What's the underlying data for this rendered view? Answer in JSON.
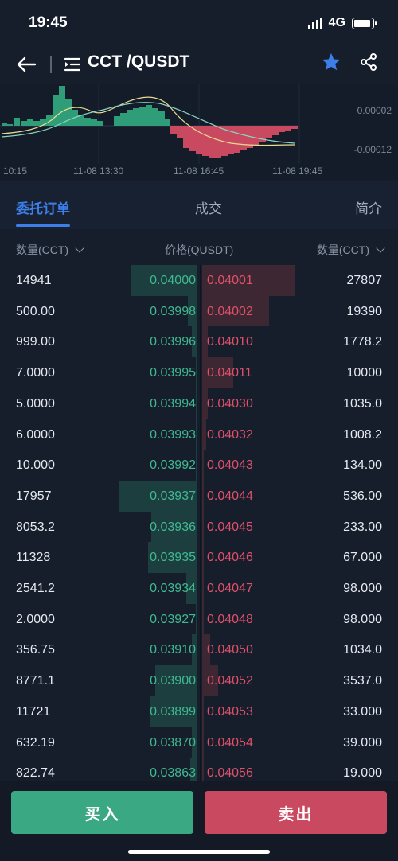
{
  "status_bar": {
    "time": "19:45",
    "network": "4G"
  },
  "header": {
    "pair": "CCT /QUSDT"
  },
  "mini_chart": {
    "y_labels": [
      "0.00002",
      "-0.00012"
    ],
    "x_labels": [
      "10:15",
      "11-08 13:30",
      "11-08 16:45",
      "11-08 19:45"
    ]
  },
  "tabs": [
    {
      "label": "委托订单",
      "active": true
    },
    {
      "label": "成交",
      "active": false
    },
    {
      "label": "简介",
      "active": false
    }
  ],
  "columns": {
    "bid_qty": "数量(CCT)",
    "price": "价格(QUSDT)",
    "ask_qty": "数量(CCT)"
  },
  "orderbook": [
    {
      "bid_qty": "14941",
      "bid_price": "0.04000",
      "ask_price": "0.04001",
      "ask_qty": "27807",
      "bid_depth": 0.36,
      "ask_depth": 0.47
    },
    {
      "bid_qty": "500.00",
      "bid_price": "0.03998",
      "ask_price": "0.04002",
      "ask_qty": "19390",
      "bid_depth": 0.05,
      "ask_depth": 0.34
    },
    {
      "bid_qty": "999.00",
      "bid_price": "0.03996",
      "ask_price": "0.04010",
      "ask_qty": "1778.2",
      "bid_depth": 0.03,
      "ask_depth": 0.03
    },
    {
      "bid_qty": "7.0000",
      "bid_price": "0.03995",
      "ask_price": "0.04011",
      "ask_qty": "10000",
      "bid_depth": 0.01,
      "ask_depth": 0.16
    },
    {
      "bid_qty": "5.0000",
      "bid_price": "0.03994",
      "ask_price": "0.04030",
      "ask_qty": "1035.0",
      "bid_depth": 0.01,
      "ask_depth": 0.03
    },
    {
      "bid_qty": "6.0000",
      "bid_price": "0.03993",
      "ask_price": "0.04032",
      "ask_qty": "1008.2",
      "bid_depth": 0.01,
      "ask_depth": 0.02
    },
    {
      "bid_qty": "10.000",
      "bid_price": "0.03992",
      "ask_price": "0.04043",
      "ask_qty": "134.00",
      "bid_depth": 0.01,
      "ask_depth": 0.01
    },
    {
      "bid_qty": "17957",
      "bid_price": "0.03937",
      "ask_price": "0.04044",
      "ask_qty": "536.00",
      "bid_depth": 0.43,
      "ask_depth": 0.01
    },
    {
      "bid_qty": "8053.2",
      "bid_price": "0.03936",
      "ask_price": "0.04045",
      "ask_qty": "233.00",
      "bid_depth": 0.25,
      "ask_depth": 0.01
    },
    {
      "bid_qty": "11328",
      "bid_price": "0.03935",
      "ask_price": "0.04046",
      "ask_qty": "67.000",
      "bid_depth": 0.27,
      "ask_depth": 0.01
    },
    {
      "bid_qty": "2541.2",
      "bid_price": "0.03934",
      "ask_price": "0.04047",
      "ask_qty": "98.000",
      "bid_depth": 0.06,
      "ask_depth": 0.01
    },
    {
      "bid_qty": "2.0000",
      "bid_price": "0.03927",
      "ask_price": "0.04048",
      "ask_qty": "98.000",
      "bid_depth": 0.01,
      "ask_depth": 0.01
    },
    {
      "bid_qty": "356.75",
      "bid_price": "0.03910",
      "ask_price": "0.04050",
      "ask_qty": "1034.0",
      "bid_depth": 0.03,
      "ask_depth": 0.04
    },
    {
      "bid_qty": "8771.1",
      "bid_price": "0.03900",
      "ask_price": "0.04052",
      "ask_qty": "3537.0",
      "bid_depth": 0.23,
      "ask_depth": 0.08
    },
    {
      "bid_qty": "11721",
      "bid_price": "0.03899",
      "ask_price": "0.04053",
      "ask_qty": "33.000",
      "bid_depth": 0.26,
      "ask_depth": 0.01
    },
    {
      "bid_qty": "632.19",
      "bid_price": "0.03870",
      "ask_price": "0.04054",
      "ask_qty": "39.000",
      "bid_depth": 0.03,
      "ask_depth": 0.01
    },
    {
      "bid_qty": "822.74",
      "bid_price": "0.03863",
      "ask_price": "0.04056",
      "ask_qty": "19.000",
      "bid_depth": 0.04,
      "ask_depth": 0.01
    }
  ],
  "actions": {
    "buy": "买入",
    "sell": "卖出"
  }
}
